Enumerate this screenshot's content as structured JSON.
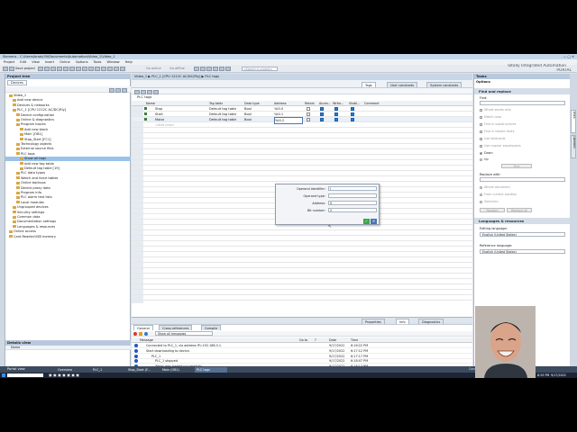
{
  "window": {
    "title": "Siemens - C:\\Users\\brody39\\Documents\\Automation\\Video_1\\Video_1",
    "brand_line1": "Totally Integrated Automation",
    "brand_line2": "PORTAL"
  },
  "menu": [
    "Project",
    "Edit",
    "View",
    "Insert",
    "Online",
    "Options",
    "Tools",
    "Window",
    "Help"
  ],
  "toolbar": {
    "save_label": "Save project",
    "go_online": "Go online",
    "go_offline": "Go offline",
    "search_placeholder": "<Search in project>"
  },
  "project_tree": {
    "title": "Project tree",
    "devices_tab": "Devices",
    "items": [
      {
        "label": "Video_1",
        "indent": 1
      },
      {
        "label": "Add new device",
        "indent": 2
      },
      {
        "label": "Devices & networks",
        "indent": 2
      },
      {
        "label": "PLC_1 [CPU 1212C AC/DC/Rly]",
        "indent": 2
      },
      {
        "label": "Device configuration",
        "indent": 3
      },
      {
        "label": "Online & diagnostics",
        "indent": 3
      },
      {
        "label": "Program blocks",
        "indent": 3
      },
      {
        "label": "Add new block",
        "indent": 4
      },
      {
        "label": "Main [OB1]",
        "indent": 4
      },
      {
        "label": "Stop_Start [FC1]",
        "indent": 4
      },
      {
        "label": "Technology objects",
        "indent": 3
      },
      {
        "label": "External source files",
        "indent": 3
      },
      {
        "label": "PLC tags",
        "indent": 3
      },
      {
        "label": "Show all tags",
        "indent": 4,
        "selected": true
      },
      {
        "label": "Add new tag table",
        "indent": 4
      },
      {
        "label": "Default tag table [19]",
        "indent": 4
      },
      {
        "label": "PLC data types",
        "indent": 3
      },
      {
        "label": "Watch and force tables",
        "indent": 3
      },
      {
        "label": "Online backups",
        "indent": 3
      },
      {
        "label": "Device proxy data",
        "indent": 3
      },
      {
        "label": "Program info",
        "indent": 3
      },
      {
        "label": "PLC alarm text lists",
        "indent": 3
      },
      {
        "label": "Local modules",
        "indent": 3
      },
      {
        "label": "Ungrouped devices",
        "indent": 2
      },
      {
        "label": "Security settings",
        "indent": 2
      },
      {
        "label": "Common data",
        "indent": 2
      },
      {
        "label": "Documentation settings",
        "indent": 2
      },
      {
        "label": "Languages & resources",
        "indent": 2
      },
      {
        "label": "Online access",
        "indent": 1
      },
      {
        "label": "Card Reader/USB memory",
        "indent": 1
      }
    ],
    "details_title": "Details view",
    "details_col": "Name"
  },
  "breadcrumb": {
    "path": "Video_1 ▶ PLC_1 [CPU 1212C AC/DC/Rly] ▶ PLC tags"
  },
  "editor_tabs": [
    "Tags",
    "User constants",
    "System constants"
  ],
  "tag_table": {
    "title": "PLC tags",
    "columns": [
      "Name",
      "Tag table",
      "Data type",
      "Address",
      "Retain",
      "Acces...",
      "Writa...",
      "Visibl...",
      "Comment"
    ],
    "rows": [
      {
        "name": "Stop",
        "table": "Default tag table",
        "type": "Bool",
        "address": "%I0.0",
        "retain": false,
        "access": true,
        "write": true,
        "visible": true
      },
      {
        "name": "Start",
        "table": "Default tag table",
        "type": "Bool",
        "address": "%I0.1",
        "retain": false,
        "access": true,
        "write": true,
        "visible": true
      },
      {
        "name": "Motor",
        "table": "Default tag table",
        "type": "Bool",
        "address": "%I0.2",
        "retain": false,
        "access": true,
        "write": true,
        "visible": true
      }
    ],
    "add_new": "<Add new>"
  },
  "address_popup": {
    "labels": [
      "Operand identifier:",
      "Operand type:",
      "Address:",
      "Bit number:"
    ],
    "values": [
      "I",
      "",
      "0",
      "2"
    ]
  },
  "inspector": {
    "tabs": [
      "Properties",
      "Info",
      "Diagnostics"
    ],
    "sub_tabs": [
      "General",
      "Cross-references",
      "Compile"
    ],
    "filter": "Show all messages",
    "columns": [
      "Message",
      "Go to",
      "?",
      "Date",
      "Time"
    ],
    "messages": [
      {
        "text": "Connected to PLC_1, via address IP=192.168.0.1.",
        "date": "9/17/2022",
        "time": "6:16:22 PM"
      },
      {
        "text": "Start downloading to device.",
        "date": "9/17/2022",
        "time": "6:17:12 PM"
      },
      {
        "text": "PLC_1",
        "date": "9/17/2022",
        "time": "6:17:17 PM"
      },
      {
        "text": "PLC_1 stopped.",
        "date": "9/17/2022",
        "time": "6:18:07 PM"
      },
      {
        "text": "'Main' was loaded successfully",
        "date": "9/17/2022",
        "time": "6:18:13 PM"
      },
      {
        "text": "PLC_1 started.",
        "date": "9/17/2022",
        "time": "6:18:14 PM"
      },
      {
        "text": "Loading completed (errors: 0; warnings: 0).",
        "date": "9/17/2022",
        "time": "6:18:17 PM"
      },
      {
        "text": "Connection to PLC_1 terminated.",
        "date": "9/17/2022",
        "time": "6:20:02 PM"
      },
      {
        "text": "Connected to PLC_1, via address IP=192.168.0.1.",
        "date": "9/17/2022",
        "time": "6:20:30 PM"
      },
      {
        "text": "Connection to PLC_1 terminated.",
        "date": "9/17/2022",
        "time": "6:24:23 PM"
      }
    ]
  },
  "tasks": {
    "title": "Tasks",
    "options_label": "Options",
    "find_replace": "Find and replace",
    "find_label": "Find:",
    "find_options": [
      "Whole words only",
      "Match case",
      "Find in substructures",
      "Find in hidden texts",
      "Use wildcards",
      "Use regular expressions"
    ],
    "direction": [
      "Down",
      "Up"
    ],
    "find_button": "Find",
    "replace_label": "Replace with:",
    "scope": [
      "Whole document",
      "From current position",
      "Selection"
    ],
    "replace_button": "Replace",
    "replace_all_button": "Replace all",
    "lang_section": "Languages & resources",
    "editing_label": "Editing language:",
    "editing_value": "English (United States)",
    "reference_label": "Reference language:",
    "reference_value": "English (United States)",
    "side_tabs": [
      "Tasks",
      "Libraries"
    ]
  },
  "portal_bar": {
    "portal_view": "Portal view",
    "tabs": [
      "Overview",
      "PLC_1",
      "Stop_Start (F...",
      "Main (OB1)",
      "PLC tags"
    ],
    "status": "Connected to PLC_1, via address IP=192..."
  },
  "taskbar": {
    "time": "6:29 PM",
    "date": "9/17/2022"
  },
  "colors": {
    "accent": "#2a7bd4",
    "titlebar": "#c7d7ea",
    "panel_header": "#b8c9dd",
    "taskbar": "#1c2636"
  }
}
